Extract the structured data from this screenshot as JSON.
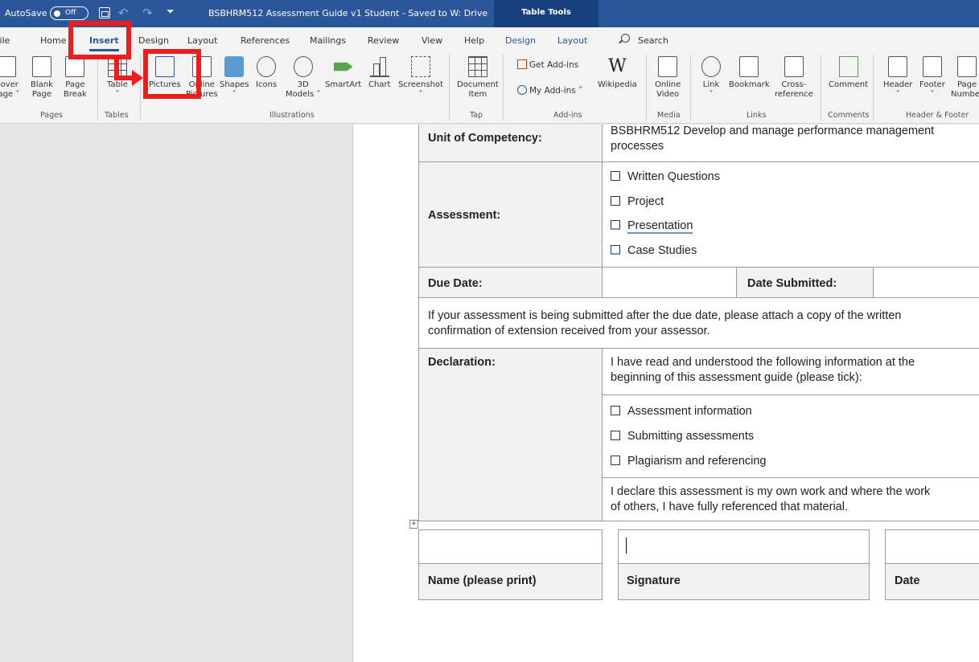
{
  "titlebar": {
    "autosave_label": "AutoSave",
    "autosave_state": "Off",
    "doc_title": "BSBHRM512 Assessment Guide v1 Student  -  Saved to W: Drive",
    "context_tab_title": "Table Tools"
  },
  "tabs": {
    "file": "File",
    "home": "Home",
    "insert": "Insert",
    "design": "Design",
    "layout": "Layout",
    "references": "References",
    "mailings": "Mailings",
    "review": "Review",
    "view": "View",
    "help": "Help",
    "table_design": "Design",
    "table_layout": "Layout",
    "search": "Search"
  },
  "ribbon": {
    "cover_page": [
      "Cover",
      "Page"
    ],
    "blank_page": [
      "Blank",
      "Page"
    ],
    "page_break": [
      "Page",
      "Break"
    ],
    "table": "Table",
    "pictures": "Pictures",
    "online_pictures": [
      "Online",
      "Pictures"
    ],
    "shapes": "Shapes",
    "icons": "Icons",
    "models_3d": [
      "3D",
      "Models"
    ],
    "smartart": "SmartArt",
    "chart": "Chart",
    "screenshot": "Screenshot",
    "document_item": [
      "Document",
      "Item"
    ],
    "get_addins": "Get Add-ins",
    "my_addins": "My Add-ins",
    "wikipedia": "Wikipedia",
    "online_video": [
      "Online",
      "Video"
    ],
    "link": "Link",
    "bookmark": "Bookmark",
    "cross_reference": [
      "Cross-",
      "reference"
    ],
    "comment": "Comment",
    "header": "Header",
    "footer": "Footer",
    "page_number": [
      "Page",
      "Number"
    ],
    "groups": {
      "pages": "Pages",
      "tables": "Tables",
      "illustrations": "Illustrations",
      "tap": "Tap",
      "addins": "Add-ins",
      "media": "Media",
      "links": "Links",
      "comments": "Comments",
      "header_footer": "Header & Footer"
    }
  },
  "document": {
    "unit_label": "Unit of Competency:",
    "unit_value": [
      "BSBHRM512 Develop and manage performance management",
      "processes"
    ],
    "assessment_label": "Assessment:",
    "assessment_options": [
      "Written Questions",
      "Project",
      "Presentation",
      "Case Studies"
    ],
    "due_date_label": "Due Date:",
    "date_submitted_label": "Date Submitted:",
    "late_notice": [
      "If your assessment is being submitted after the due date, please attach a copy of the written",
      "confirmation of extension received from your assessor."
    ],
    "declaration_label": "Declaration:",
    "declaration_intro": [
      "I have read and understood the following information at the",
      "beginning of this assessment guide (please tick):"
    ],
    "declaration_options": [
      "Assessment information",
      "Submitting assessments",
      "Plagiarism and referencing"
    ],
    "declaration_statement": [
      "I declare this assessment is my own work and where the work",
      "of others, I have fully referenced that material."
    ],
    "name_label": "Name (please print)",
    "signature_label": "Signature",
    "date_label": "Date"
  },
  "colors": {
    "titlebar": "#2b579a",
    "context_tab": "#17407e",
    "highlight": "#ee1c1c",
    "label_shade": "#f2f2f2"
  }
}
